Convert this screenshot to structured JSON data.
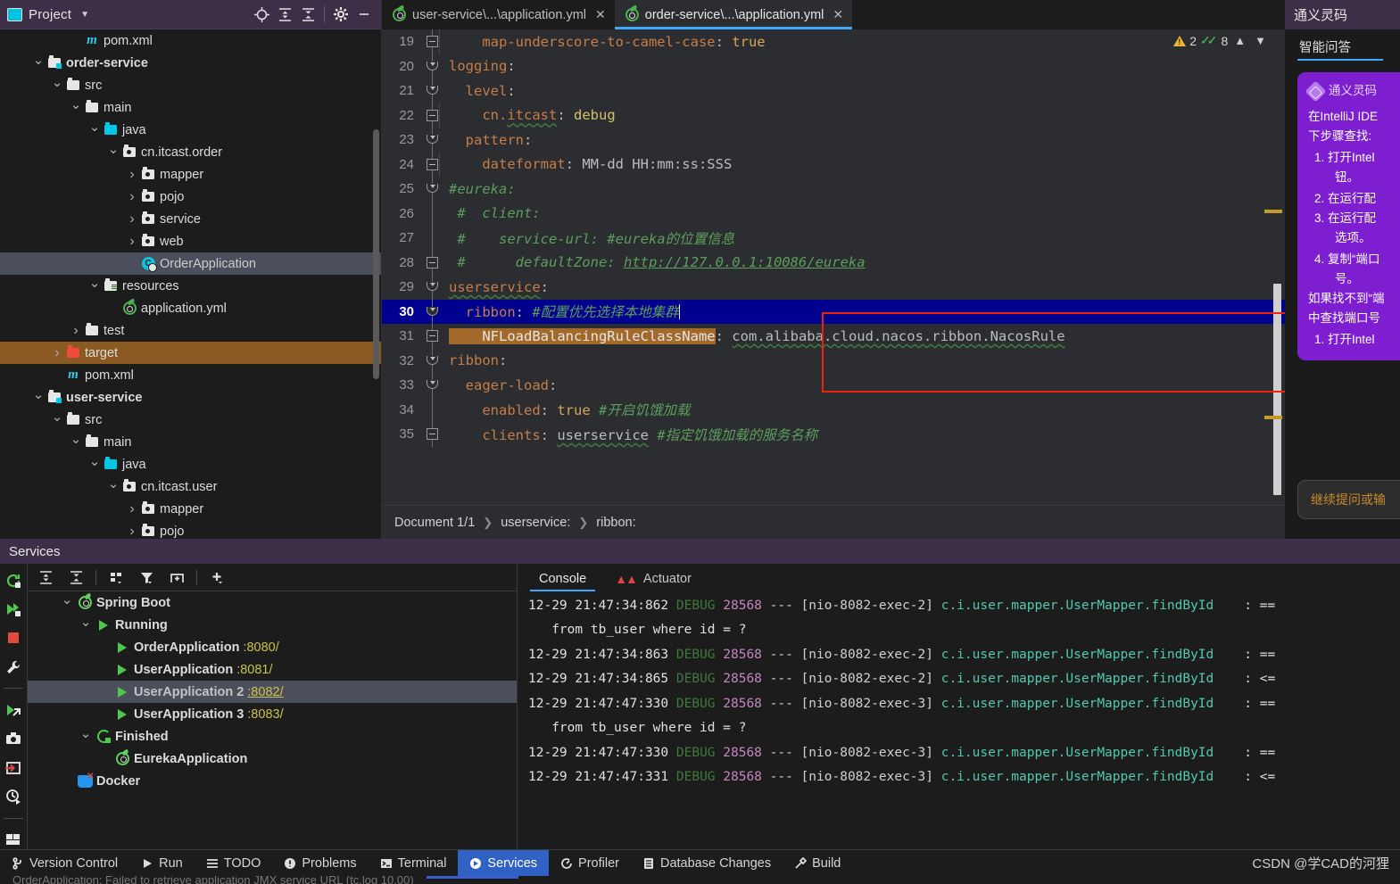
{
  "project_panel": {
    "title": "Project",
    "toolbar_icons": [
      "locate-icon",
      "expand-all-icon",
      "collapse-all-icon",
      "settings-gear-icon",
      "minimize-icon"
    ],
    "tree": [
      {
        "indent": 3,
        "arrow": "none",
        "icon": "maven-icon",
        "label": "pom.xml",
        "bold": false,
        "state": "normal"
      },
      {
        "indent": 1,
        "arrow": "down",
        "icon": "module-icon",
        "label": "order-service",
        "bold": true,
        "state": "normal"
      },
      {
        "indent": 2,
        "arrow": "down",
        "icon": "folder-icon",
        "label": "src",
        "bold": false,
        "state": "normal"
      },
      {
        "indent": 3,
        "arrow": "down",
        "icon": "folder-icon",
        "label": "main",
        "bold": false,
        "state": "normal"
      },
      {
        "indent": 4,
        "arrow": "down",
        "icon": "source-root-icon",
        "label": "java",
        "bold": false,
        "state": "normal"
      },
      {
        "indent": 5,
        "arrow": "down",
        "icon": "package-icon",
        "label": "cn.itcast.order",
        "bold": false,
        "state": "normal"
      },
      {
        "indent": 6,
        "arrow": "right",
        "icon": "package-icon",
        "label": "mapper",
        "bold": false,
        "state": "normal"
      },
      {
        "indent": 6,
        "arrow": "right",
        "icon": "package-icon",
        "label": "pojo",
        "bold": false,
        "state": "normal"
      },
      {
        "indent": 6,
        "arrow": "right",
        "icon": "package-icon",
        "label": "service",
        "bold": false,
        "state": "normal"
      },
      {
        "indent": 6,
        "arrow": "right",
        "icon": "package-icon",
        "label": "web",
        "bold": false,
        "state": "normal"
      },
      {
        "indent": 6,
        "arrow": "none",
        "icon": "spring-class-icon",
        "label": "OrderApplication",
        "bold": false,
        "state": "selected"
      },
      {
        "indent": 4,
        "arrow": "down",
        "icon": "resources-icon",
        "label": "resources",
        "bold": false,
        "state": "normal"
      },
      {
        "indent": 5,
        "arrow": "none",
        "icon": "yaml-icon",
        "label": "application.yml",
        "bold": false,
        "state": "normal"
      },
      {
        "indent": 3,
        "arrow": "right",
        "icon": "folder-icon",
        "label": "test",
        "bold": false,
        "state": "normal"
      },
      {
        "indent": 2,
        "arrow": "right",
        "icon": "excluded-folder-icon",
        "label": "target",
        "bold": false,
        "state": "target-selected"
      },
      {
        "indent": 2,
        "arrow": "none",
        "icon": "maven-icon",
        "label": "pom.xml",
        "bold": false,
        "state": "normal"
      },
      {
        "indent": 1,
        "arrow": "down",
        "icon": "module-icon",
        "label": "user-service",
        "bold": true,
        "state": "normal"
      },
      {
        "indent": 2,
        "arrow": "down",
        "icon": "folder-icon",
        "label": "src",
        "bold": false,
        "state": "normal"
      },
      {
        "indent": 3,
        "arrow": "down",
        "icon": "folder-icon",
        "label": "main",
        "bold": false,
        "state": "normal"
      },
      {
        "indent": 4,
        "arrow": "down",
        "icon": "source-root-icon",
        "label": "java",
        "bold": false,
        "state": "normal"
      },
      {
        "indent": 5,
        "arrow": "down",
        "icon": "package-icon",
        "label": "cn.itcast.user",
        "bold": false,
        "state": "normal"
      },
      {
        "indent": 6,
        "arrow": "right",
        "icon": "package-icon",
        "label": "mapper",
        "bold": false,
        "state": "normal"
      },
      {
        "indent": 6,
        "arrow": "right",
        "icon": "package-icon",
        "label": "pojo",
        "bold": false,
        "state": "normal"
      }
    ]
  },
  "editor": {
    "tabs": [
      {
        "label": "user-service\\...\\application.yml",
        "active": false
      },
      {
        "label": "order-service\\...\\application.yml",
        "active": true
      }
    ],
    "close_glyph": "✕",
    "inspections": {
      "warning_count": "2",
      "ok_count": "8"
    },
    "breadcrumb": [
      "Document 1/1",
      "userservice:",
      "ribbon:"
    ],
    "lines": [
      {
        "num": "19",
        "fold": "minus",
        "indent": true,
        "html": "<span class='k-key'>    map-underscore-to-camel-case</span><span class='k-plain'>: </span><span class='k-num'>true</span>"
      },
      {
        "num": "20",
        "fold": "down",
        "indent": false,
        "html": "<span class='k-key'>logging</span><span class='k-plain'>:</span>"
      },
      {
        "num": "21",
        "fold": "down",
        "indent": false,
        "html": "<span class='k-key'>  level</span><span class='k-plain'>:</span>"
      },
      {
        "num": "22",
        "fold": "minus",
        "indent": true,
        "html": "<span class='k-key'>    cn.</span><span class='k-key k-wavy'>itcast</span><span class='k-plain'>: </span><span class='k-yel'>debug</span>"
      },
      {
        "num": "23",
        "fold": "down",
        "indent": false,
        "html": "<span class='k-key'>  pattern</span><span class='k-plain'>:</span>"
      },
      {
        "num": "24",
        "fold": "minus",
        "indent": true,
        "html": "<span class='k-key'>    dateformat</span><span class='k-plain'>: MM-dd HH:mm:ss:SSS</span>"
      },
      {
        "num": "25",
        "fold": "down",
        "indent": false,
        "html": "<span class='k-cmt'>#eureka:</span>"
      },
      {
        "num": "26",
        "fold": "none",
        "indent": false,
        "html": "<span class='k-cmt'> #  client:</span>"
      },
      {
        "num": "27",
        "fold": "none",
        "indent": false,
        "html": "<span class='k-cmt'> #    service-url: #eureka的位置信息</span>"
      },
      {
        "num": "28",
        "fold": "minus",
        "indent": false,
        "html": "<span class='k-cmt'> #      defaultZone: </span><span class='k-link'>http://127.0.0.1:10086/eureka</span>"
      },
      {
        "num": "29",
        "fold": "down",
        "indent": false,
        "html": "<span class='k-key k-wavy'>userservice</span><span class='k-plain'>:</span>"
      },
      {
        "num": "30",
        "fold": "down",
        "indent": false,
        "highlight": true,
        "html": "<span class='k-key'>  ribbon</span><span class='k-plain'>: </span><span class='k-cmt'>#配置优先选择本地集群</span><span class='caret'></span>"
      },
      {
        "num": "31",
        "fold": "minus",
        "indent": false,
        "html": "<span class='k-sel'>    NFLoadBalancingRuleClassName</span><span class='k-plain'>: </span><span class='k-plain k-wavy'>com.alibaba.cloud.nacos.ribbon.NacosRule</span>"
      },
      {
        "num": "32",
        "fold": "down",
        "indent": false,
        "html": "<span class='k-key'>ribbon</span><span class='k-plain'>:</span>"
      },
      {
        "num": "33",
        "fold": "down",
        "indent": false,
        "html": "<span class='k-key'>  eager-load</span><span class='k-plain'>:</span>"
      },
      {
        "num": "34",
        "fold": "none",
        "indent": false,
        "html": "<span class='k-key'>    enabled</span><span class='k-plain'>: </span><span class='k-num'>true</span><span class='k-cmt'> #开启饥饿加载</span>"
      },
      {
        "num": "35",
        "fold": "minus",
        "indent": false,
        "html": "<span class='k-key'>    clients</span><span class='k-plain'>: </span><span class='k-plain k-wavy'>userservice</span><span class='k-cmt'> #指定饥饿加载的服务名称</span>"
      }
    ]
  },
  "ai_panel": {
    "header": "通义灵码",
    "tab": "智能问答",
    "brand": "通义灵码",
    "intro_line1": "在IntelliJ IDE",
    "intro_line2": "下步骤查找:",
    "steps": [
      "打开Intel",
      "在运行配",
      "在运行配",
      "复制“端口"
    ],
    "step1_cont": "钮。",
    "step3_cont": "选项。",
    "step4_cont": "号。",
    "note_line1": "如果找不到“端",
    "note_line2": "中查找端口号",
    "steps2": [
      "打开Intel"
    ],
    "input_placeholder": "继续提问或输"
  },
  "services": {
    "header": "Services",
    "rail_icons": [
      "rerun-icon",
      "rerun-failed-icon",
      "stop-icon",
      "settings-wrench-icon",
      "run-with-icon",
      "camera-icon",
      "import-icon",
      "history-icon",
      "layout-icon"
    ],
    "toolbar_icons": [
      "expand-all-icon",
      "collapse-all-icon",
      "group-by-icon",
      "filter-icon",
      "add-tab-icon",
      "add-icon"
    ],
    "tree": [
      {
        "indent": 1,
        "arrow": "down",
        "icon": "spring-boot-icon",
        "label": "Spring Boot",
        "port": "",
        "state": "normal"
      },
      {
        "indent": 2,
        "arrow": "down",
        "icon": "play-icon",
        "label": "Running",
        "port": "",
        "state": "normal"
      },
      {
        "indent": 3,
        "arrow": "none",
        "icon": "play-icon",
        "label": "OrderApplication",
        "port": ":8080/",
        "state": "normal"
      },
      {
        "indent": 3,
        "arrow": "none",
        "icon": "play-icon",
        "label": "UserApplication",
        "port": ":8081/",
        "state": "normal"
      },
      {
        "indent": 3,
        "arrow": "none",
        "icon": "play-icon",
        "label": "UserApplication 2",
        "port": ":8082/",
        "state": "selected"
      },
      {
        "indent": 3,
        "arrow": "none",
        "icon": "play-icon",
        "label": "UserApplication 3",
        "port": ":8083/",
        "state": "normal"
      },
      {
        "indent": 2,
        "arrow": "down",
        "icon": "restart-icon",
        "label": "Finished",
        "port": "",
        "state": "normal"
      },
      {
        "indent": 3,
        "arrow": "none",
        "icon": "spring-boot-icon",
        "label": "EurekaApplication",
        "port": "",
        "state": "normal"
      },
      {
        "indent": 1,
        "arrow": "none",
        "icon": "docker-icon",
        "label": "Docker",
        "port": "",
        "state": "normal"
      }
    ],
    "console_tabs": [
      {
        "label": "Console",
        "active": true
      },
      {
        "label": "Actuator",
        "active": false
      }
    ],
    "console_lines": [
      {
        "type": "log",
        "ts": "12-29 21:47:34:862",
        "level": "DEBUG",
        "pid": "28568",
        "thread": "[nio-8082-exec-2]",
        "logger": "c.i.user.mapper.UserMapper.findById",
        "tail": ": =="
      },
      {
        "type": "sql",
        "text": "   from tb_user where id = ?"
      },
      {
        "type": "log",
        "ts": "12-29 21:47:34:863",
        "level": "DEBUG",
        "pid": "28568",
        "thread": "[nio-8082-exec-2]",
        "logger": "c.i.user.mapper.UserMapper.findById",
        "tail": ": =="
      },
      {
        "type": "log",
        "ts": "12-29 21:47:34:865",
        "level": "DEBUG",
        "pid": "28568",
        "thread": "[nio-8082-exec-2]",
        "logger": "c.i.user.mapper.UserMapper.findById",
        "tail": ": <="
      },
      {
        "type": "log",
        "ts": "12-29 21:47:47:330",
        "level": "DEBUG",
        "pid": "28568",
        "thread": "[nio-8082-exec-3]",
        "logger": "c.i.user.mapper.UserMapper.findById",
        "tail": ": =="
      },
      {
        "type": "sql",
        "text": "   from tb_user where id = ?"
      },
      {
        "type": "log",
        "ts": "12-29 21:47:47:330",
        "level": "DEBUG",
        "pid": "28568",
        "thread": "[nio-8082-exec-3]",
        "logger": "c.i.user.mapper.UserMapper.findById",
        "tail": ": =="
      },
      {
        "type": "log",
        "ts": "12-29 21:47:47:331",
        "level": "DEBUG",
        "pid": "28568",
        "thread": "[nio-8082-exec-3]",
        "logger": "c.i.user.mapper.UserMapper.findById",
        "tail": ": <="
      }
    ]
  },
  "statusbar": {
    "items": [
      {
        "label": "Version Control",
        "icon": "branch-icon",
        "active": false
      },
      {
        "label": "Run",
        "icon": "play-icon",
        "active": false
      },
      {
        "label": "TODO",
        "icon": "list-icon",
        "active": false
      },
      {
        "label": "Problems",
        "icon": "error-icon",
        "active": false
      },
      {
        "label": "Terminal",
        "icon": "terminal-icon",
        "active": false
      },
      {
        "label": "Services",
        "icon": "services-icon",
        "active": true
      },
      {
        "label": "Profiler",
        "icon": "profiler-icon",
        "active": false
      },
      {
        "label": "Database Changes",
        "icon": "database-icon",
        "active": false
      },
      {
        "label": "Build",
        "icon": "hammer-icon",
        "active": false
      }
    ],
    "watermark": "CSDN @学CAD的河狸",
    "clipped_text": "OrderApplication: Failed to retrieve application JMX service URL (tc.log 10.00)"
  }
}
